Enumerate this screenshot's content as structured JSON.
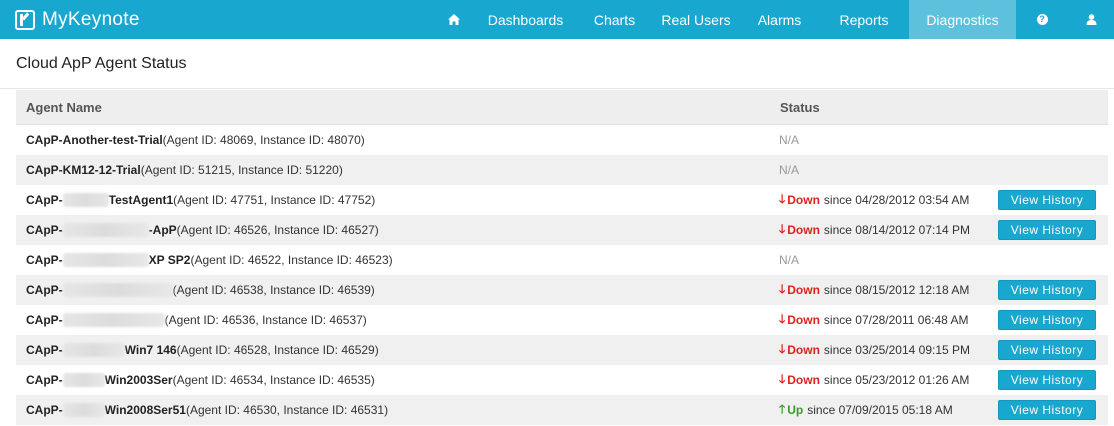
{
  "brand": {
    "name": "MyKeynote"
  },
  "nav": {
    "items": [
      {
        "label": "Dashboards"
      },
      {
        "label": "Charts"
      },
      {
        "label": "Real Users"
      },
      {
        "label": "Alarms"
      },
      {
        "label": "Reports"
      },
      {
        "label": "Diagnostics",
        "active": true
      }
    ],
    "home_icon": "home-icon",
    "help_icon": "question-circle-icon",
    "user_icon": "user-icon"
  },
  "page": {
    "title": "Cloud ApP Agent Status"
  },
  "table": {
    "headers": {
      "name": "Agent Name",
      "status": "Status"
    },
    "view_history_label": "View History",
    "rows": [
      {
        "name_bold": "CApP-Another-test-Trial",
        "name_rest": " (Agent ID: 48069, Instance ID: 48070)",
        "status": "N/A",
        "since": ""
      },
      {
        "name_bold": "CApP-KM12-12-Trial",
        "name_rest": " (Agent ID: 51215, Instance ID: 51220)",
        "status": "N/A",
        "since": ""
      },
      {
        "name_bold": "CApP-",
        "name_bold2": "TestAgent1",
        "name_rest": " (Agent ID: 47751, Instance ID: 47752)",
        "status": "Down",
        "since": "since 04/28/2012 03:54 AM"
      },
      {
        "name_bold": "CApP-",
        "name_bold2": "-ApP",
        "name_rest": " (Agent ID: 46526, Instance ID: 46527)",
        "status": "Down",
        "since": "since 08/14/2012 07:14 PM"
      },
      {
        "name_bold": "CApP-",
        "name_bold2": "XP SP2",
        "name_rest": " (Agent ID: 46522, Instance ID: 46523)",
        "status": "N/A",
        "since": ""
      },
      {
        "name_bold": "CApP-",
        "name_bold2": "",
        "name_rest": " (Agent ID: 46538, Instance ID: 46539)",
        "status": "Down",
        "since": "since 08/15/2012 12:18 AM"
      },
      {
        "name_bold": "CApP-",
        "name_bold2": "",
        "name_rest": " (Agent ID: 46536, Instance ID: 46537)",
        "status": "Down",
        "since": "since 07/28/2011 06:48 AM"
      },
      {
        "name_bold": "CApP-",
        "name_bold2": "Win7 146",
        "name_rest": " (Agent ID: 46528, Instance ID: 46529)",
        "status": "Down",
        "since": "since 03/25/2014 09:15 PM"
      },
      {
        "name_bold": "CApP-",
        "name_bold2": "Win2003Ser",
        "name_rest": " (Agent ID: 46534, Instance ID: 46535)",
        "status": "Down",
        "since": "since 05/23/2012 01:26 AM"
      },
      {
        "name_bold": "CApP-",
        "name_bold2": "Win2008Ser51",
        "name_rest": " (Agent ID: 46530, Instance ID: 46531)",
        "status": "Up",
        "since": "since 07/09/2015 05:18 AM"
      }
    ]
  },
  "colors": {
    "navbar": "#18a7cf",
    "active_tab": "#5dc0dd",
    "down": "#e0211b",
    "up": "#3c9a2c",
    "na": "#999999"
  }
}
